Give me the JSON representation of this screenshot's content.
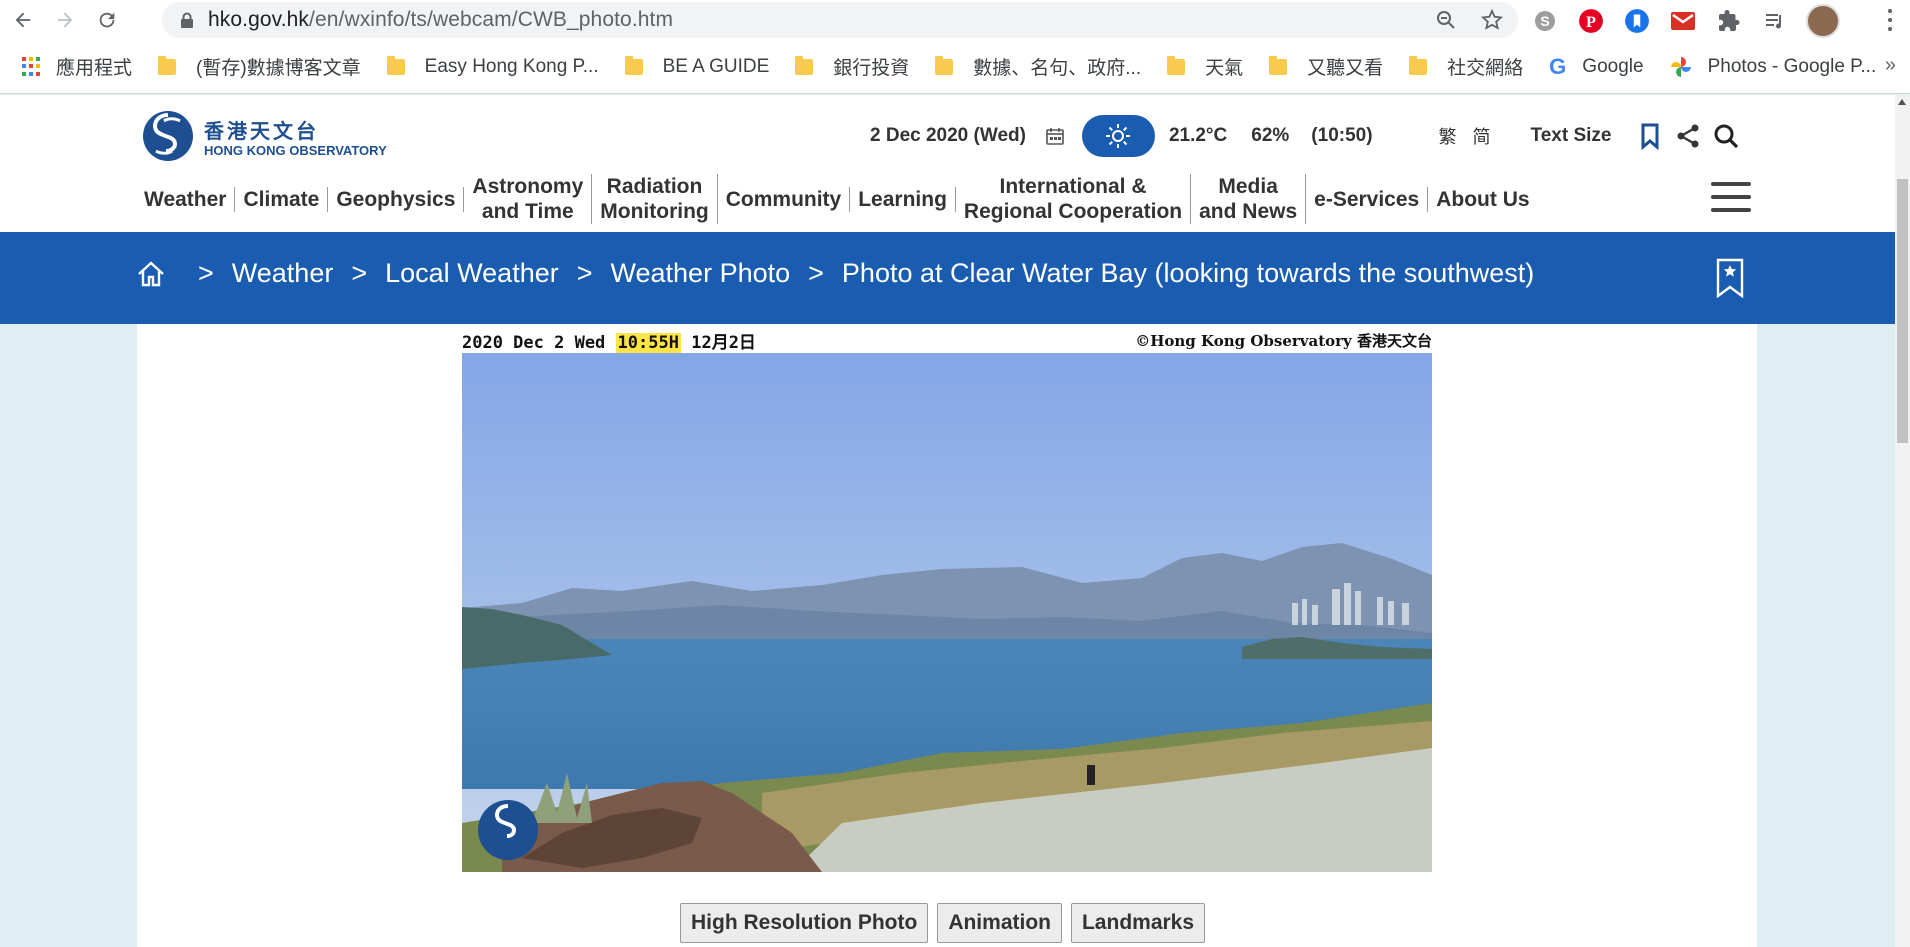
{
  "browser": {
    "url_host": "hko.gov.hk",
    "url_path": "/en/wxinfo/ts/webcam/CWB_photo.htm"
  },
  "bookmarks": [
    {
      "label": "應用程式",
      "icon": "apps-grid-icon"
    },
    {
      "label": "(暫存)數據博客文章",
      "icon": "folder-icon"
    },
    {
      "label": "Easy Hong Kong P...",
      "icon": "folder-icon"
    },
    {
      "label": "BE A GUIDE",
      "icon": "folder-icon"
    },
    {
      "label": "銀行投資",
      "icon": "folder-icon"
    },
    {
      "label": "數據、名句、政府...",
      "icon": "folder-icon"
    },
    {
      "label": "天氣",
      "icon": "folder-icon"
    },
    {
      "label": "又聽又看",
      "icon": "folder-icon"
    },
    {
      "label": "社交網絡",
      "icon": "folder-icon"
    },
    {
      "label": "Google",
      "icon": "google-icon"
    },
    {
      "label": "Photos - Google P...",
      "icon": "google-photos-icon"
    }
  ],
  "bookmarks_more": "»",
  "site": {
    "logo_zh": "香港天文台",
    "logo_en": "HONG KONG OBSERVATORY",
    "date": "2 Dec 2020 (Wed)",
    "temperature": "21.2°C",
    "humidity": "62%",
    "obs_time": "(10:50)",
    "lang_trad": "繁",
    "lang_simp": "简",
    "text_size": "Text Size"
  },
  "nav": [
    [
      "Weather"
    ],
    [
      "Climate"
    ],
    [
      "Geophysics"
    ],
    [
      "Astronomy",
      "and Time"
    ],
    [
      "Radiation",
      "Monitoring"
    ],
    [
      "Community"
    ],
    [
      "Learning"
    ],
    [
      "International &",
      "Regional Cooperation"
    ],
    [
      "Media",
      "and News"
    ],
    [
      "e-Services"
    ],
    [
      "About Us"
    ]
  ],
  "breadcrumb": {
    "sep": ">",
    "items": [
      "Weather",
      "Local Weather",
      "Weather Photo",
      "Photo at Clear Water Bay (looking towards the southwest)"
    ]
  },
  "webcam": {
    "date_text": "2020 Dec 2 Wed",
    "time_text": "10:55H",
    "zh_date": "12月2日",
    "copyright": "©Hong Kong Observatory 香港天文台"
  },
  "buttons": {
    "high_res": "High Resolution Photo",
    "animation": "Animation",
    "landmarks": "Landmarks"
  },
  "colors": {
    "brand_blue": "#1a5cb0",
    "timestamp_highlight": "#ffe447",
    "page_bg": "#dfeef2"
  }
}
